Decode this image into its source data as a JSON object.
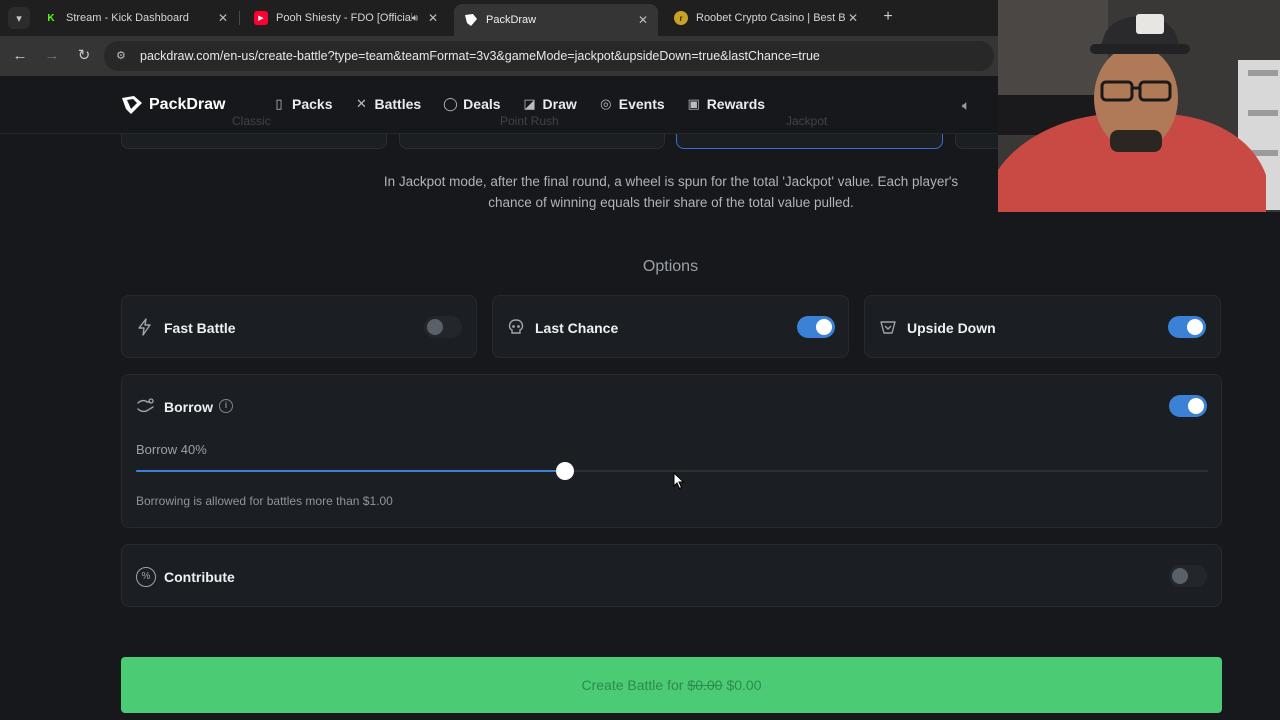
{
  "browser": {
    "tabs": [
      {
        "title": "Stream - Kick Dashboard",
        "favicon": "kick-icon",
        "active": false
      },
      {
        "title": "Pooh Shiesty - FDO [Official",
        "favicon": "youtube-icon",
        "active": false,
        "audio": true
      },
      {
        "title": "PackDraw",
        "favicon": "packdraw-icon",
        "active": true
      },
      {
        "title": "Roobet Crypto Casino | Best Bit",
        "favicon": "roobet-icon",
        "active": false
      }
    ],
    "url": "packdraw.com/en-us/create-battle?type=team&teamFormat=3v3&gameMode=jackpot&upsideDown=true&lastChance=true"
  },
  "site": {
    "brand": "PackDraw",
    "nav": [
      {
        "label": "Packs",
        "icon": "packs-icon"
      },
      {
        "label": "Battles",
        "icon": "swords-icon"
      },
      {
        "label": "Deals",
        "icon": "deals-icon"
      },
      {
        "label": "Draw",
        "icon": "draw-icon"
      },
      {
        "label": "Events",
        "icon": "events-icon"
      },
      {
        "label": "Rewards",
        "icon": "gift-icon"
      }
    ],
    "mode_tabs": [
      "Classic",
      "Point Rush",
      "Jackpot"
    ]
  },
  "content": {
    "jackpot_description": "In Jackpot mode, after the final round, a wheel is spun for the total 'Jackpot' value. Each player's chance of winning equals their share of the total value pulled.",
    "options_title": "Options",
    "options": [
      {
        "label": "Fast Battle",
        "icon": "lightning-icon",
        "enabled": false
      },
      {
        "label": "Last Chance",
        "icon": "skull-icon",
        "enabled": true
      },
      {
        "label": "Upside Down",
        "icon": "upside-down-icon",
        "enabled": true
      }
    ],
    "borrow": {
      "label": "Borrow",
      "enabled": true,
      "percent_label": "Borrow 40%",
      "percent": 0.4,
      "note": "Borrowing is allowed for battles more than $1.00"
    },
    "contribute": {
      "label": "Contribute",
      "enabled": false
    },
    "create_button": {
      "prefix": "Create Battle for",
      "old_price": "$0.00",
      "price": "$0.00"
    }
  },
  "colors": {
    "accent_blue": "#3b82d6",
    "create_green": "#4bcb73",
    "background": "#16181c"
  }
}
